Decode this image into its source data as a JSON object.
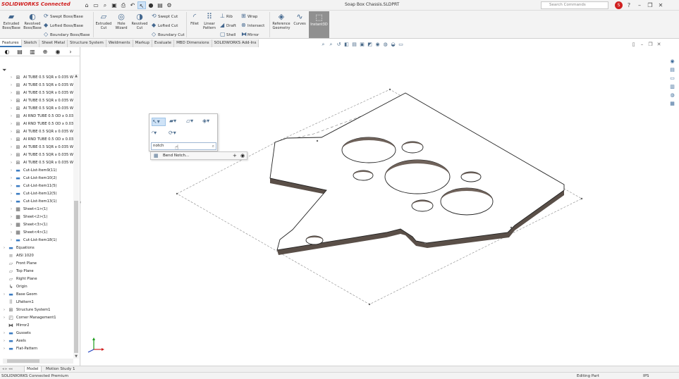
{
  "app": {
    "logo": "SOLIDWORKS Connected",
    "document_title": "Soap Box Chassis.SLDPRT"
  },
  "search_commands": {
    "placeholder": "Search Commands"
  },
  "quick_access": [
    "home-icon",
    "new-icon",
    "open-icon",
    "save-icon",
    "print-icon",
    "undo-icon",
    "select-icon",
    "rebuild-icon",
    "file-properties-icon",
    "options-icon"
  ],
  "ribbon": {
    "extruded_boss": "Extruded Boss/Base",
    "revolved_boss": "Revolved Boss/Base",
    "swept_boss": "Swept Boss/Base",
    "lofted_boss": "Lofted Boss/Base",
    "boundary_boss": "Boundary Boss/Base",
    "extruded_cut": "Extruded Cut",
    "hole_wizard": "Hole Wizard",
    "revolved_cut": "Revolved Cut",
    "swept_cut": "Swept Cut",
    "lofted_cut": "Lofted Cut",
    "boundary_cut": "Boundary Cut",
    "fillet": "Fillet",
    "linear_pattern": "Linear Pattern",
    "rib": "Rib",
    "draft": "Draft",
    "shell": "Shell",
    "wrap": "Wrap",
    "intersect": "Intersect",
    "mirror": "Mirror",
    "reference_geometry": "Reference Geometry",
    "curves": "Curves",
    "instant3d": "Instant3D"
  },
  "tabs": [
    "Features",
    "Sketch",
    "Sheet Metal",
    "Structure System",
    "Weldments",
    "Markup",
    "Evaluate",
    "MBD Dimensions",
    "SOLIDWORKS Add-Ins"
  ],
  "active_tab": "Features",
  "tree": [
    {
      "label": "AI TUBE 0.5 SQR x 0.035 W...",
      "icon": "weldment-member-icon",
      "level": 2
    },
    {
      "label": "AI TUBE 0.5 SQR x 0.035 W...",
      "icon": "weldment-member-icon",
      "level": 2
    },
    {
      "label": "AI TUBE 0.5 SQR x 0.035 W...",
      "icon": "weldment-member-icon",
      "level": 2
    },
    {
      "label": "AI TUBE 0.5 SQR x 0.035 W...",
      "icon": "weldment-member-icon",
      "level": 2
    },
    {
      "label": "AI TUBE 0.5 SQR x 0.035 W...",
      "icon": "weldment-member-icon",
      "level": 2
    },
    {
      "label": "AI RND TUBE 0.5 OD x 0.03...",
      "icon": "weldment-member-icon",
      "level": 2
    },
    {
      "label": "AI RND TUBE 0.5 OD x 0.03...",
      "icon": "weldment-member-icon",
      "level": 2
    },
    {
      "label": "AI TUBE 0.5 SQR x 0.035 W...",
      "icon": "weldment-member-icon",
      "level": 2
    },
    {
      "label": "AI RND TUBE 0.5 OD x 0.03...",
      "icon": "weldment-member-icon",
      "level": 2
    },
    {
      "label": "AI TUBE 0.5 SQR x 0.035 W...",
      "icon": "weldment-member-icon",
      "level": 2
    },
    {
      "label": "AI TUBE 0.5 SQR x 0.035 W...",
      "icon": "weldment-member-icon",
      "level": 2
    },
    {
      "label": "AI TUBE 0.5 SQR x 0.035 W...",
      "icon": "weldment-member-icon",
      "level": 2
    },
    {
      "label": "Cut-List-Item9(11)",
      "icon": "cut-list-folder-icon",
      "level": 2
    },
    {
      "label": "Cut-List-Item10(2)",
      "icon": "cut-list-folder-icon",
      "level": 2
    },
    {
      "label": "Cut-List-Item11(5)",
      "icon": "cut-list-folder-icon",
      "level": 2
    },
    {
      "label": "Cut-List-Item12(5)",
      "icon": "cut-list-folder-icon",
      "level": 2
    },
    {
      "label": "Cut-List-Item13(1)",
      "icon": "cut-list-folder-icon",
      "level": 2
    },
    {
      "label": "Sheet<1>(1)",
      "icon": "sheet-metal-icon",
      "level": 2
    },
    {
      "label": "Sheet<2>(1)",
      "icon": "sheet-metal-icon",
      "level": 2
    },
    {
      "label": "Sheet<3>(1)",
      "icon": "sheet-metal-icon",
      "level": 2
    },
    {
      "label": "Sheet<4>(1)",
      "icon": "sheet-metal-icon",
      "level": 2
    },
    {
      "label": "Cut-List-Item18(1)",
      "icon": "cut-list-folder-icon",
      "level": 2
    },
    {
      "label": "Equations",
      "icon": "equations-folder-icon",
      "level": 1
    },
    {
      "label": "AISI 1020",
      "icon": "material-icon",
      "level": 1
    },
    {
      "label": "Front Plane",
      "icon": "plane-icon",
      "level": 1
    },
    {
      "label": "Top Plane",
      "icon": "plane-icon",
      "level": 1
    },
    {
      "label": "Right Plane",
      "icon": "plane-icon",
      "level": 1
    },
    {
      "label": "Origin",
      "icon": "origin-icon",
      "level": 1
    },
    {
      "label": "Base Geom",
      "icon": "folder-icon",
      "level": 1
    },
    {
      "label": "LPattern1",
      "icon": "linear-pattern-icon",
      "level": 1
    },
    {
      "label": "Structure System1",
      "icon": "structure-system-icon",
      "level": 1
    },
    {
      "label": "Corner Management1",
      "icon": "corner-management-icon",
      "level": 1
    },
    {
      "label": "Mirror2",
      "icon": "mirror-icon",
      "level": 1
    },
    {
      "label": "Gussets",
      "icon": "folder-icon",
      "level": 1
    },
    {
      "label": "Axels",
      "icon": "folder-icon",
      "level": 1
    },
    {
      "label": "Flat-Pattern",
      "icon": "folder-icon",
      "level": 1
    }
  ],
  "popup": {
    "search_value": "notch",
    "suggestion": "Bend Notch..."
  },
  "bottom_tabs": [
    "Model",
    "Motion Study 1"
  ],
  "status": {
    "product": "SOLIDWORKS Connected Premium",
    "mode": "Editing Part",
    "units": "IPS"
  },
  "colors": {
    "brand_red": "#d02020",
    "accent_blue": "#3a78b9",
    "part_gray": "#6f625a"
  }
}
